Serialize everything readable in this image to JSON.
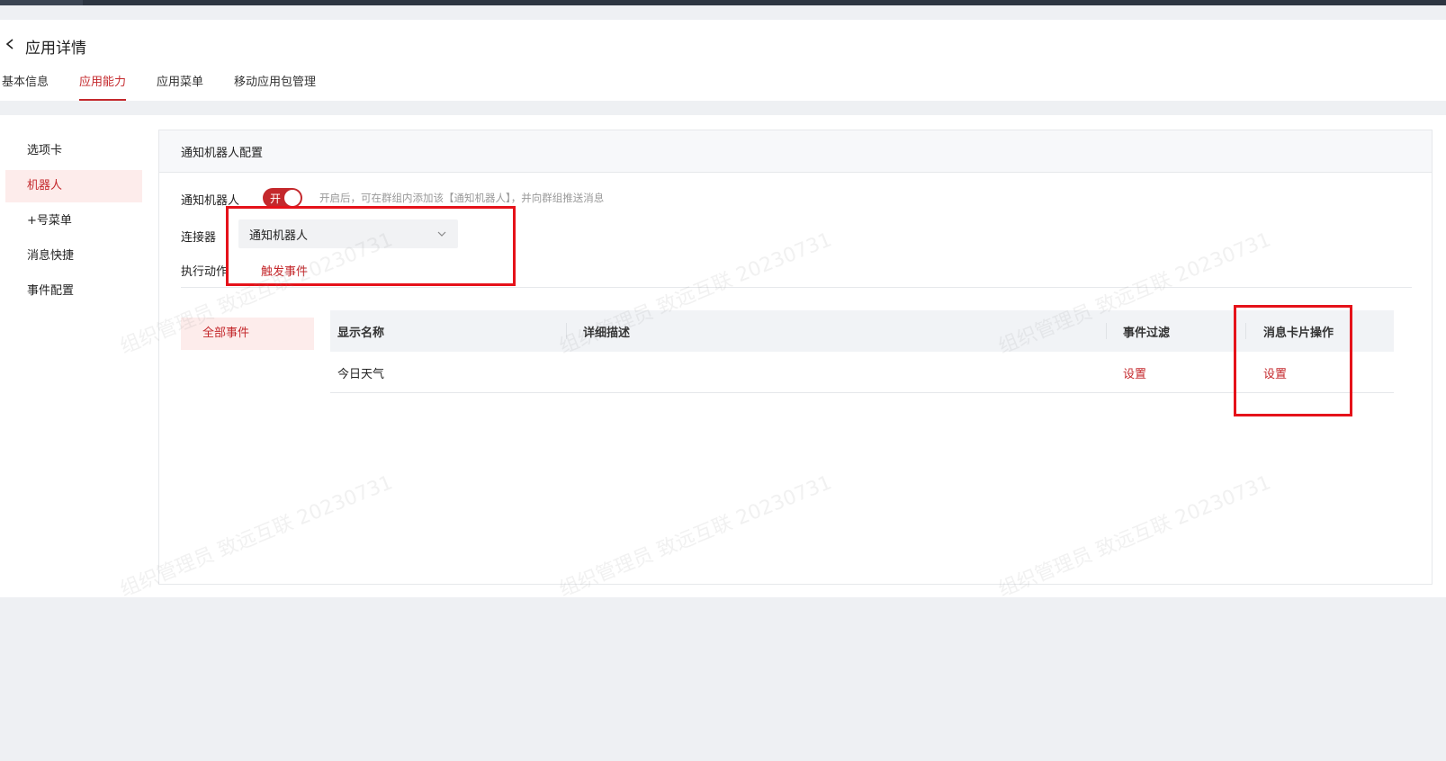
{
  "header": {
    "back_label": "<",
    "title": "应用详情",
    "tabs": [
      {
        "label": "基本信息"
      },
      {
        "label": "应用能力"
      },
      {
        "label": "应用菜单"
      },
      {
        "label": "移动应用包管理"
      }
    ],
    "active_tab": "应用能力"
  },
  "sidebar": {
    "items": [
      {
        "label": "选项卡"
      },
      {
        "label": "机器人"
      },
      {
        "label": "+号菜单"
      },
      {
        "label": "消息快捷"
      },
      {
        "label": "事件配置"
      }
    ],
    "active_item": "机器人"
  },
  "panel": {
    "title": "通知机器人配置",
    "robot_label": "通知机器人",
    "toggle": {
      "on": true,
      "text": "开"
    },
    "toggle_hint": "开启后，可在群组内添加该【通知机器人】，并向群组推送消息",
    "connector_label": "连接器",
    "connector_value": "通知机器人",
    "action_label": "执行动作",
    "action_link": "触发事件"
  },
  "events": {
    "tab_label": "全部事件",
    "columns": [
      "显示名称",
      "详细描述",
      "事件过滤",
      "消息卡片操作"
    ],
    "rows": [
      {
        "name": "今日天气",
        "description": "",
        "filter_link": "设置",
        "card_link": "设置"
      }
    ]
  },
  "watermark": "组织管理员 致远互联 20230731",
  "colors": {
    "accent": "#c4282c",
    "annotation_red": "#e5121a",
    "active_bg": "#fdeceb",
    "topbar": "#2d3541"
  }
}
